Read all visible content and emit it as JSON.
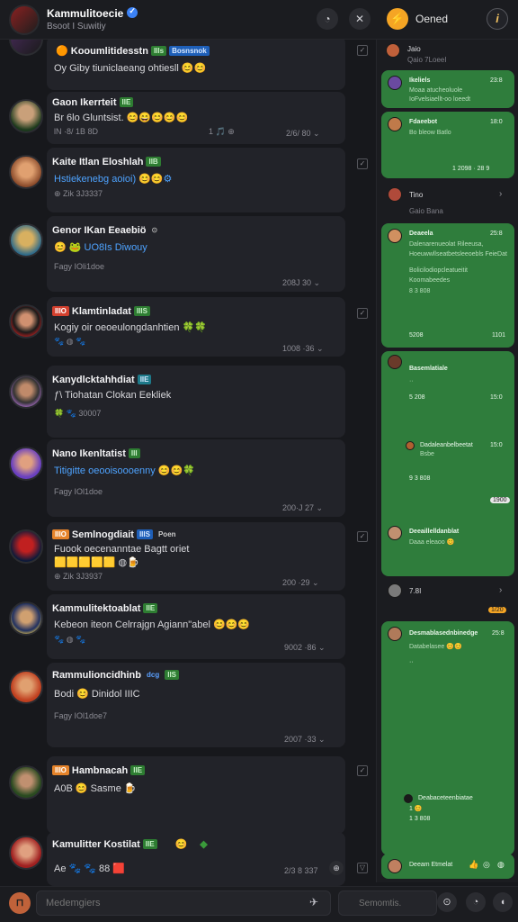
{
  "header": {
    "title": "Kammulitoecie",
    "subtitle": "Bsoot I Suwitiy",
    "done_label": "Oened"
  },
  "cards": [
    {
      "name": "Kooumlitidesstn",
      "tag": "IIIs",
      "tag2": "Bosnsnok",
      "msg": "Oy Giby  tiuniclaeang ohtiesll 😊😊",
      "meta": "",
      "time": ""
    },
    {
      "name": "Gaon Ikerrteit",
      "tag": "IIE",
      "msg": "Br 6lo  Gluntsist. 😊😄😊😊😊",
      "meta": "lN  ·8/  1B  8D",
      "meta2": "1 🎵 ⊕",
      "time": "2/6/  80  ⌄"
    },
    {
      "name": "Kaite Itlan Eloshlah",
      "tag": "IIB",
      "msg": "Hstiekenebg aoioi) 😊😊⚙",
      "meta": "⊕  Zik  3J3337",
      "time": ""
    },
    {
      "name": "Genor IKan Eeaebiö",
      "tag": "⊙",
      "msg": "😊 🐸  UO8Is  Diwouy",
      "meta": "Fagy  IOli1doe",
      "time": "208J  30  ⌄"
    },
    {
      "name": "Klamtinladat",
      "tag": "IIIS",
      "tag_pre": "IIIO",
      "msg": "Kogiy oir  oeoeulongdanhtien 🍀🍀",
      "meta": "🐾  ◍  🐾",
      "time": "1008  ·36  ⌄"
    },
    {
      "name": "Kanydlcktahhdiat",
      "tag": "IIE",
      "msg": "ƒ\\ Tiohatan  Clokan  Eekliek",
      "meta": "🍀  🐾  30007",
      "time": ""
    },
    {
      "name": "Nano Ikenltatist",
      "tag": "III",
      "msg": "Titigitte  oeooisoooenny 😊😊🍀",
      "meta": "Fagy  IOl1doe",
      "time": "200·J  27  ⌄"
    },
    {
      "name": "Semlnogdiait",
      "tag": "IIIS",
      "tag_pre": "IIIO",
      "tag3": "Poen",
      "msg": "Fuook  oecenanntae  Bagtt  oriet",
      "msg2": "🟨🟨🟨🟨🟨  ◍🍺",
      "meta": "⊕  Zik  3J3937",
      "time": "200  ·29  ⌄"
    },
    {
      "name": "Kammulitektoablat",
      "tag": "IIE",
      "msg": "Kebeon  iteon  Celrrajgn  Agiann\"abel 😊😊😊",
      "meta": "🐾  ◍  🐾",
      "time": "9002  ·86  ⌄"
    },
    {
      "name": "Rammulioncidhinb",
      "tag": "IIS",
      "tag_pre": "dcg",
      "msg": "Bodi 😊  Dinidol  IIIC",
      "meta": "Fagy  IOl1doe7",
      "time": "2007  ·33  ⌄"
    },
    {
      "name": "Hambnacah",
      "tag": "IIE",
      "tag_pre": "IIIO",
      "msg": "A0B 😊  Sasme  🍺",
      "meta": "",
      "time": ""
    },
    {
      "name": "Kamulitter  Kostilat",
      "tag": "IIE",
      "msg": "Ae 🐾  🐾  88  🟥",
      "meta": "",
      "time": "2/3 8  337"
    }
  ],
  "right_panel": {
    "items": [
      {
        "name": "Jaio",
        "time": "",
        "line": "Qaio 7LoeeI",
        "type": "plain"
      },
      {
        "name": "Ikeliels",
        "time": "23:8",
        "line": "Moaa atucheoluole",
        "line2": "IoFvelsiaellt-oo loeedt",
        "type": "green_a"
      },
      {
        "name": "Fdaeebot",
        "time": "18:0",
        "line": "Bo bleow  Batlo",
        "time2": "1  2098 · 28  9",
        "type": "green_b"
      },
      {
        "name": "Tino",
        "time": "",
        "line": "Gaio  Bana",
        "type": "plain2"
      },
      {
        "name": "Deaeela",
        "time": "25:8",
        "line": "Dalenarenueolat Rileeusa,",
        "line2": "Hoeuwwllseatbetsleeoebls  FeieDat",
        "line3": "Bolicilodiopcleatueitit",
        "line4": "Koomabeedes",
        "line5": "8  3 808",
        "time2": "5208",
        "time3": "1101",
        "type": "green_c"
      },
      {
        "name": "Basemlatiale",
        "time": "",
        "line": "··",
        "line2": "5  208",
        "time2": "15:0",
        "line3": "Dadaleanbelbeetat",
        "line4": "Bsbe",
        "time3": "15:0",
        "line5": "9  3 808",
        "badge": "1900",
        "type": "green_d"
      },
      {
        "name": "Deeaillelldanblat",
        "time": "",
        "line": "Daaa eleaoo 😊",
        "type": "green_e"
      },
      {
        "name": "7.8I",
        "time": "",
        "badge": "1/20",
        "type": "plain3"
      },
      {
        "name": "Desmablasednbinedge",
        "time": "25:8",
        "line": "Databelasee 😊😊",
        "line2": "··",
        "line3": "Deabaceteenbiatae",
        "line4": "1 😊",
        "line5": "1  3 808",
        "type": "green_f"
      },
      {
        "name": "Deeam Etmelat",
        "type": "green_g"
      }
    ]
  },
  "composer": {
    "placeholder": "Medemgiers",
    "search_placeholder": "Semomtis."
  }
}
